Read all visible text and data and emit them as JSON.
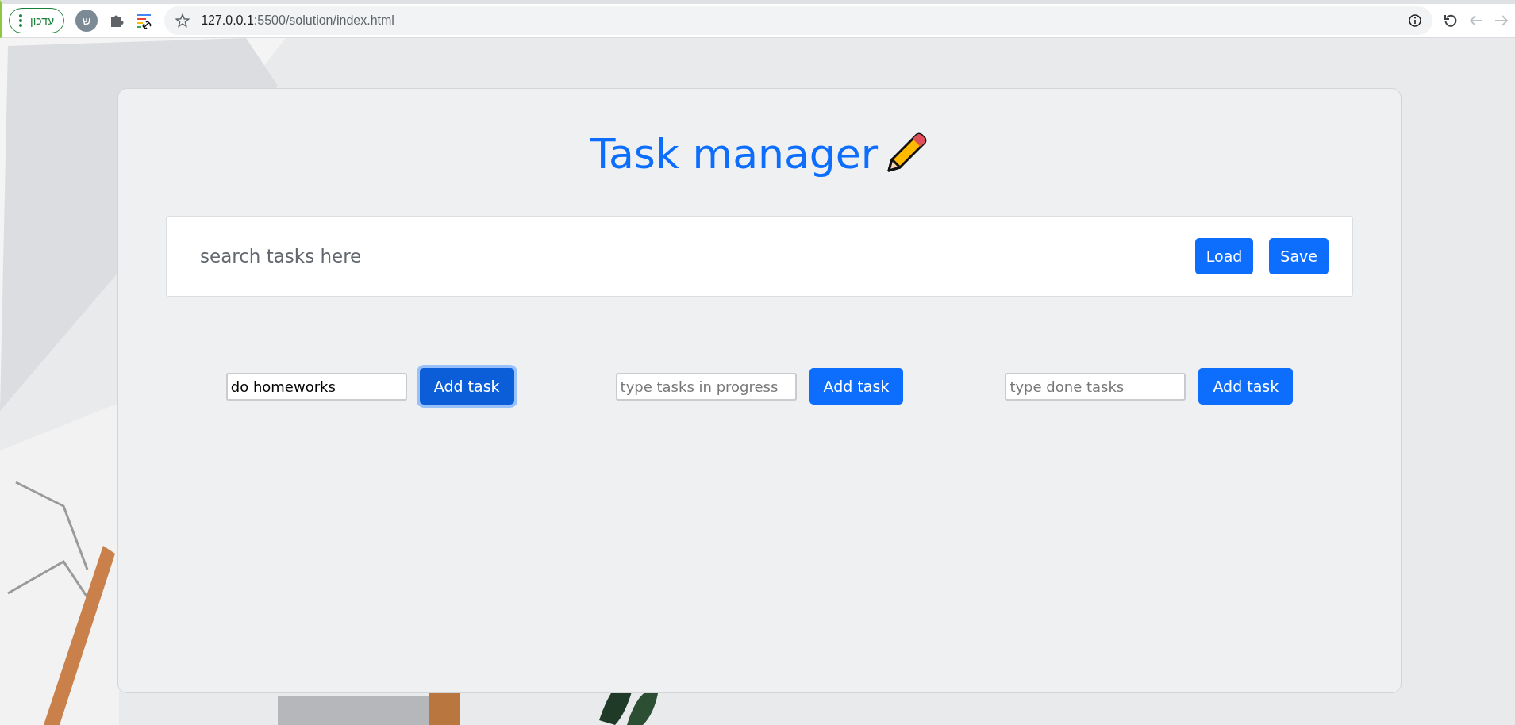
{
  "browser": {
    "update_button": "עדכון",
    "profile_initial": "ש",
    "url_host": "127.0.0.1",
    "url_path": ":5500/solution/index.html"
  },
  "title": "Task manager",
  "search": {
    "placeholder": "search tasks here"
  },
  "actions": [
    "Load",
    "Save"
  ],
  "columns": [
    {
      "value": "do homeworks",
      "button": "Add task",
      "focused": true
    },
    {
      "placeholder": "type tasks in progress",
      "button": "Add task",
      "focused": false
    },
    {
      "placeholder": "type done tasks",
      "button": "Add task",
      "focused": false
    }
  ]
}
